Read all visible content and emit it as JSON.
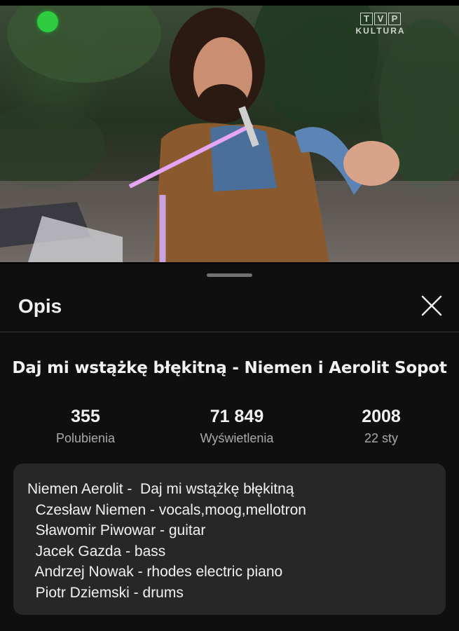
{
  "video": {
    "channel_logo_letters": [
      "T",
      "V",
      "P"
    ],
    "channel_logo_sub": "KULTURA"
  },
  "sheet": {
    "title": "Opis",
    "video_title": "Daj mi wstążkę błękitną - Niemen i Aerolit Sopot",
    "stats": [
      {
        "value": "355",
        "label": "Polubienia"
      },
      {
        "value": "71 849",
        "label": "Wyświetlenia"
      },
      {
        "value": "2008",
        "label": "22 sty"
      }
    ],
    "description_lines": [
      "Niemen Aerolit -  Daj mi wstążkę błękitną",
      "  Czesław Niemen - vocals,moog,mellotron",
      "  Sławomir Piwowar - guitar",
      "  Jacek Gazda - bass",
      "  Andrzej Nowak - rhodes electric piano",
      "  Piotr Dziemski - drums"
    ]
  },
  "icons": {
    "close": "close-icon"
  },
  "colors": {
    "background": "#0f0f0f",
    "card": "#272727",
    "secondary_text": "#aaaaaa"
  }
}
